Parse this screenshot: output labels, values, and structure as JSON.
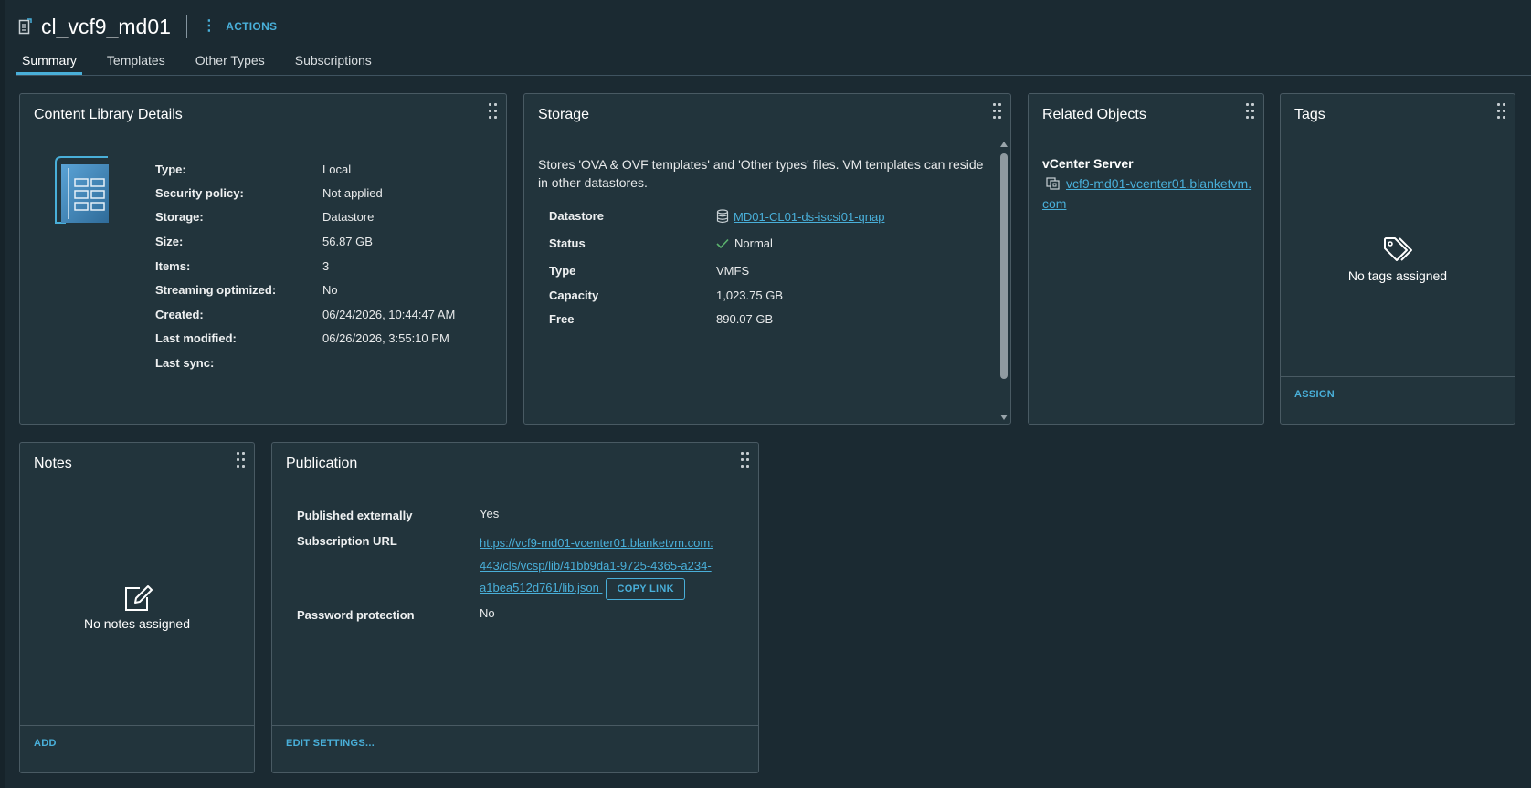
{
  "header": {
    "title": "cl_vcf9_md01",
    "actions_label": "ACTIONS",
    "icon": "content-library-icon"
  },
  "tabs": [
    {
      "label": "Summary",
      "active": true
    },
    {
      "label": "Templates",
      "active": false
    },
    {
      "label": "Other Types",
      "active": false
    },
    {
      "label": "Subscriptions",
      "active": false
    }
  ],
  "details": {
    "title": "Content Library Details",
    "rows": [
      {
        "label": "Type:",
        "value": "Local"
      },
      {
        "label": "Security policy:",
        "value": "Not applied"
      },
      {
        "label": "Storage:",
        "value": "Datastore"
      },
      {
        "label": "Size:",
        "value": "56.87 GB"
      },
      {
        "label": "Items:",
        "value": "3"
      },
      {
        "label": "Streaming optimized:",
        "value": "No"
      },
      {
        "label": "Created:",
        "value": "06/24/2026, 10:44:47 AM"
      },
      {
        "label": "Last modified:",
        "value": "06/26/2026, 3:55:10 PM"
      },
      {
        "label": "Last sync:",
        "value": ""
      }
    ]
  },
  "storage": {
    "title": "Storage",
    "description": "Stores 'OVA & OVF templates' and 'Other types' files. VM templates can reside in other datastores.",
    "rows": [
      {
        "label": "Datastore",
        "value": "MD01-CL01-ds-iscsi01-qnap"
      },
      {
        "label": "Status",
        "value": "Normal"
      },
      {
        "label": "Type",
        "value": "VMFS"
      },
      {
        "label": "Capacity",
        "value": "1,023.75 GB"
      },
      {
        "label": "Free",
        "value": "890.07 GB"
      }
    ]
  },
  "related": {
    "title": "Related Objects",
    "section_label": "vCenter Server",
    "link": "vcf9-md01-vcenter01.blanketvm.com"
  },
  "tags": {
    "title": "Tags",
    "empty_text": "No tags assigned",
    "assign_label": "ASSIGN"
  },
  "notes": {
    "title": "Notes",
    "empty_text": "No notes assigned",
    "add_label": "ADD"
  },
  "publication": {
    "title": "Publication",
    "published_label": "Published externally",
    "published_value": "Yes",
    "url_label": "Subscription URL",
    "url_value": "https://vcf9-md01-vcenter01.blanketvm.com:443/cls/vcsp/lib/41bb9da1-9725-4365-a234-a1bea512d761/lib.json",
    "url_line1": "https://vcf9-md01-vcenter01.blanketvm.com:",
    "url_line2": "443/cls/vcsp/lib/41bb9da1-9725-4365-a234-",
    "url_line3": "a1bea512d761/lib.json",
    "copy_label": "COPY LINK",
    "password_label": "Password protection",
    "password_value": "No",
    "edit_label": "EDIT SETTINGS..."
  },
  "colors": {
    "background": "#1b2a32",
    "card": "#22343c",
    "accent": "#49afd9",
    "success": "#5bb36e"
  }
}
